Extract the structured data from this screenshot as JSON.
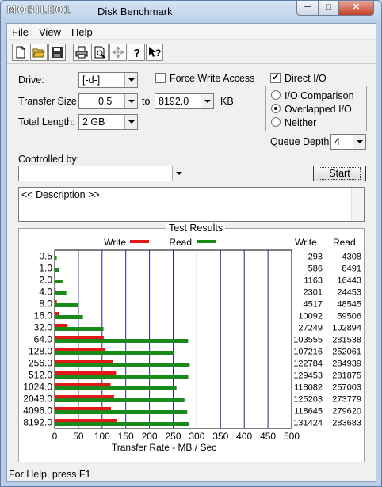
{
  "window": {
    "logo_text": "MOBILE01",
    "title": "Disk Benchmark",
    "min_label": "─",
    "max_label": "□",
    "close_label": "✕"
  },
  "menu": {
    "file": "File",
    "view": "View",
    "help": "Help"
  },
  "toolbar": {
    "buttons": [
      "new-icon",
      "open-icon",
      "save-icon",
      "print-icon",
      "print-preview-icon",
      "move-icon",
      "help-icon",
      "context-help-icon"
    ]
  },
  "settings": {
    "drive_label": "Drive:",
    "drive_value": "[-d-]",
    "transfer_size_label": "Transfer Size:",
    "transfer_from": "0.5",
    "to_label": "to",
    "transfer_to": "8192.0",
    "kb_label": "KB",
    "total_length_label": "Total Length:",
    "total_length_value": "2 GB",
    "force_write_access_label": "Force Write Access",
    "force_write_access_checked": false,
    "direct_io_label": "Direct I/O",
    "direct_io_checked": true,
    "io_comparison_label": "I/O Comparison",
    "overlapped_io_label": "Overlapped I/O",
    "neither_label": "Neither",
    "selected_mode": "Overlapped I/O",
    "queue_depth_label": "Queue Depth:",
    "queue_depth_value": "4",
    "controlled_by_label": "Controlled by:",
    "controlled_by_value": "",
    "start_label": "Start",
    "description_text": "<< Description >>"
  },
  "results": {
    "group_title": "Test Results",
    "legend_write": "Write",
    "legend_read": "Read",
    "col_write": "Write",
    "col_read": "Read",
    "write_color": "#e01818",
    "read_color": "#1a8a1a",
    "grid_color": "#1e2a8c",
    "xlabel": "Transfer Rate - MB / Sec"
  },
  "chart_data": {
    "type": "bar",
    "orientation": "horizontal",
    "categories": [
      "0.5",
      "1.0",
      "2.0",
      "4.0",
      "8.0",
      "16.0",
      "32.0",
      "64.0",
      "128.0",
      "256.0",
      "512.0",
      "1024.0",
      "2048.0",
      "4096.0",
      "8192.0"
    ],
    "series": [
      {
        "name": "Write",
        "values": [
          293,
          586,
          1163,
          2301,
          4517,
          10092,
          27249,
          103555,
          107216,
          122784,
          129453,
          118082,
          125203,
          118645,
          131424
        ]
      },
      {
        "name": "Read",
        "values": [
          4308,
          8491,
          16443,
          24453,
          48545,
          59506,
          102894,
          281538,
          252061,
          284939,
          281875,
          257003,
          273779,
          279620,
          283683
        ]
      }
    ],
    "value_unit_divisor": 1000,
    "xlabel": "Transfer Rate - MB / Sec",
    "xlim": [
      0,
      500
    ],
    "xticks": [
      "0",
      "50",
      "100",
      "150",
      "200",
      "250",
      "300",
      "350",
      "400",
      "450",
      "500"
    ],
    "legend": "top-center",
    "grid": true
  },
  "status": {
    "text": "For Help, press F1"
  }
}
